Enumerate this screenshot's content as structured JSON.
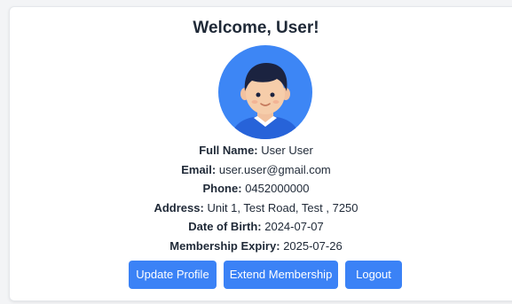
{
  "header": {
    "title": "Welcome, User!"
  },
  "profile": {
    "fields": [
      {
        "label": "Full Name:",
        "value": "User User"
      },
      {
        "label": "Email:",
        "value": "user.user@gmail.com"
      },
      {
        "label": "Phone:",
        "value": "0452000000"
      },
      {
        "label": "Address:",
        "value": "Unit 1, Test Road, Test , 7250"
      },
      {
        "label": "Date of Birth:",
        "value": "2024-07-07"
      },
      {
        "label": "Membership Expiry:",
        "value": "2025-07-26"
      }
    ]
  },
  "actions": {
    "update_label": "Update Profile",
    "extend_label": "Extend Membership",
    "logout_label": "Logout"
  },
  "colors": {
    "primary": "#3b82f6",
    "avatar_bg": "#3d86f5",
    "text": "#1f2937"
  },
  "icons": {
    "avatar": "user-avatar-icon"
  }
}
